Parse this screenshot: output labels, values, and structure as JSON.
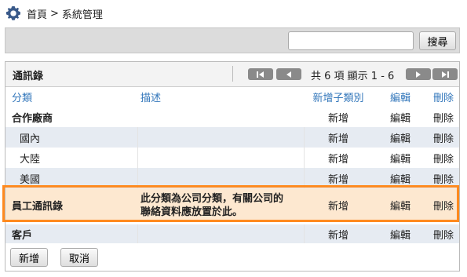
{
  "breadcrumb": {
    "home": "首頁",
    "separator": ">",
    "current": "系統管理"
  },
  "search": {
    "button_label": "搜尋",
    "value": "",
    "placeholder": ""
  },
  "panel": {
    "title": "通訊錄",
    "pager": {
      "first_icon": "first-page-icon",
      "prev_icon": "prev-page-icon",
      "next_icon": "next-page-icon",
      "last_icon": "last-page-icon",
      "info": "共 6 項 顯示 1 - 6"
    }
  },
  "columns": {
    "category": "分類",
    "description": "描述",
    "add_sub": "新增子類別",
    "edit": "編輯",
    "delete": "刪除"
  },
  "rows": [
    {
      "name": "合作廠商",
      "description": "",
      "add": "新增",
      "edit": "編輯",
      "delete": "刪除"
    },
    {
      "name": "國內",
      "description": "",
      "add": "新增",
      "edit": "編輯",
      "delete": "刪除"
    },
    {
      "name": "大陸",
      "description": "",
      "add": "新增",
      "edit": "編輯",
      "delete": "刪除"
    },
    {
      "name": "美國",
      "description": "",
      "add": "新增",
      "edit": "編輯",
      "delete": "刪除"
    },
    {
      "name": "員工通訊錄",
      "description_line1": "此分類為公司分類，有關公司的",
      "description_line2": "聯絡資料應放置於此。",
      "add": "新增",
      "edit": "編輯",
      "delete": "刪除"
    },
    {
      "name": "客戶",
      "description": "",
      "add": "新增",
      "edit": "編輯",
      "delete": "刪除"
    }
  ],
  "actions": {
    "add": "新增",
    "cancel": "取消"
  },
  "colors": {
    "accent": "#3377bb",
    "highlight_border": "#ff8a1f",
    "highlight_bg": "#fde8d0",
    "row_alt": "#e6ebf2"
  }
}
